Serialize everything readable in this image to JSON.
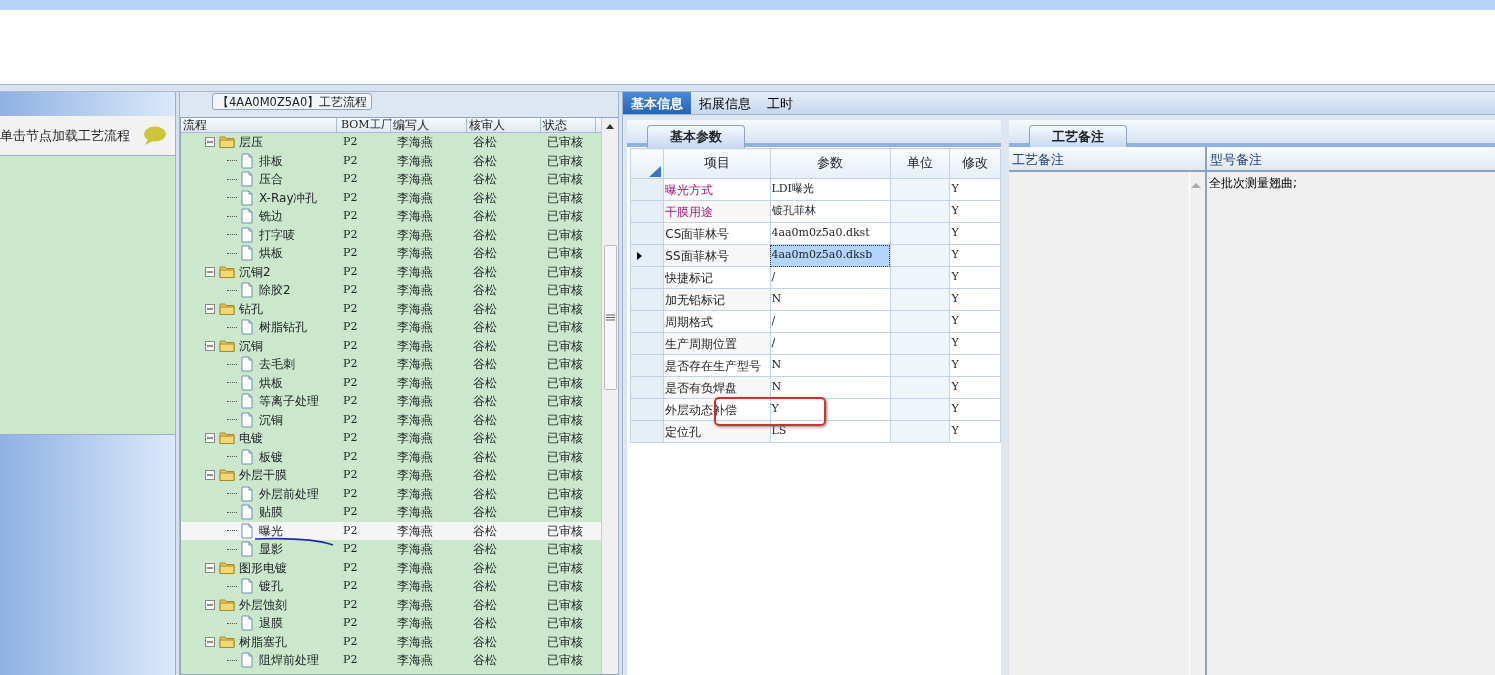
{
  "top_grid": {
    "rows": [
      {
        "selected": true
      }
    ]
  },
  "left_panel": {
    "hint": "单击节点加载工艺流程"
  },
  "process_panel": {
    "title": "【4AA0M0Z5A0】工艺流程",
    "columns": [
      "流程",
      "BOM工厂",
      "编写人",
      "核审人",
      "状态"
    ],
    "rows": [
      {
        "kind": "folder",
        "name": "层压",
        "bom": "P2",
        "writer": "李海燕",
        "reviewer": "谷松",
        "status": "已审核",
        "selected": false,
        "expanded": true,
        "children": [
          {
            "kind": "file",
            "name": "排板",
            "bom": "P2",
            "writer": "李海燕",
            "reviewer": "谷松",
            "status": "已审核",
            "selected": false
          },
          {
            "kind": "file",
            "name": "压合",
            "bom": "P2",
            "writer": "李海燕",
            "reviewer": "谷松",
            "status": "已审核",
            "selected": false
          },
          {
            "kind": "file",
            "name": "X-Ray冲孔",
            "bom": "P2",
            "writer": "李海燕",
            "reviewer": "谷松",
            "status": "已审核",
            "selected": false
          },
          {
            "kind": "file",
            "name": "铣边",
            "bom": "P2",
            "writer": "李海燕",
            "reviewer": "谷松",
            "status": "已审核",
            "selected": false
          },
          {
            "kind": "file",
            "name": "打字唛",
            "bom": "P2",
            "writer": "李海燕",
            "reviewer": "谷松",
            "status": "已审核",
            "selected": false
          },
          {
            "kind": "file",
            "name": "烘板",
            "bom": "P2",
            "writer": "李海燕",
            "reviewer": "谷松",
            "status": "已审核",
            "selected": false
          }
        ]
      },
      {
        "kind": "folder",
        "name": "沉铜2",
        "bom": "P2",
        "writer": "李海燕",
        "reviewer": "谷松",
        "status": "已审核",
        "selected": false,
        "expanded": true,
        "children": [
          {
            "kind": "file",
            "name": "除胶2",
            "bom": "P2",
            "writer": "李海燕",
            "reviewer": "谷松",
            "status": "已审核",
            "selected": false
          }
        ]
      },
      {
        "kind": "folder",
        "name": "钻孔",
        "bom": "P2",
        "writer": "李海燕",
        "reviewer": "谷松",
        "status": "已审核",
        "selected": false,
        "expanded": true,
        "children": [
          {
            "kind": "file",
            "name": "树脂钻孔",
            "bom": "P2",
            "writer": "李海燕",
            "reviewer": "谷松",
            "status": "已审核",
            "selected": false
          }
        ]
      },
      {
        "kind": "folder",
        "name": "沉铜",
        "bom": "P2",
        "writer": "李海燕",
        "reviewer": "谷松",
        "status": "已审核",
        "selected": false,
        "expanded": true,
        "children": [
          {
            "kind": "file",
            "name": "去毛刺",
            "bom": "P2",
            "writer": "李海燕",
            "reviewer": "谷松",
            "status": "已审核",
            "selected": false
          },
          {
            "kind": "file",
            "name": "烘板",
            "bom": "P2",
            "writer": "李海燕",
            "reviewer": "谷松",
            "status": "已审核",
            "selected": false
          },
          {
            "kind": "file",
            "name": "等离子处理",
            "bom": "P2",
            "writer": "李海燕",
            "reviewer": "谷松",
            "status": "已审核",
            "selected": false
          },
          {
            "kind": "file",
            "name": "沉铜",
            "bom": "P2",
            "writer": "李海燕",
            "reviewer": "谷松",
            "status": "已审核",
            "selected": false
          }
        ]
      },
      {
        "kind": "folder",
        "name": "电镀",
        "bom": "P2",
        "writer": "李海燕",
        "reviewer": "谷松",
        "status": "已审核",
        "selected": false,
        "expanded": true,
        "children": [
          {
            "kind": "file",
            "name": "板镀",
            "bom": "P2",
            "writer": "李海燕",
            "reviewer": "谷松",
            "status": "已审核",
            "selected": false
          }
        ]
      },
      {
        "kind": "folder",
        "name": "外层干膜",
        "bom": "P2",
        "writer": "李海燕",
        "reviewer": "谷松",
        "status": "已审核",
        "selected": false,
        "expanded": true,
        "children": [
          {
            "kind": "file",
            "name": "外层前处理",
            "bom": "P2",
            "writer": "李海燕",
            "reviewer": "谷松",
            "status": "已审核",
            "selected": false
          },
          {
            "kind": "file",
            "name": "贴膜",
            "bom": "P2",
            "writer": "李海燕",
            "reviewer": "谷松",
            "status": "已审核",
            "selected": false
          },
          {
            "kind": "file",
            "name": "曝光",
            "bom": "P2",
            "writer": "李海燕",
            "reviewer": "谷松",
            "status": "已审核",
            "selected": true
          },
          {
            "kind": "file",
            "name": "显影",
            "bom": "P2",
            "writer": "李海燕",
            "reviewer": "谷松",
            "status": "已审核",
            "selected": false
          }
        ]
      },
      {
        "kind": "folder",
        "name": "图形电镀",
        "bom": "P2",
        "writer": "李海燕",
        "reviewer": "谷松",
        "status": "已审核",
        "selected": false,
        "expanded": true,
        "children": [
          {
            "kind": "file",
            "name": "镀孔",
            "bom": "P2",
            "writer": "李海燕",
            "reviewer": "谷松",
            "status": "已审核",
            "selected": false
          }
        ]
      },
      {
        "kind": "folder",
        "name": "外层蚀刻",
        "bom": "P2",
        "writer": "李海燕",
        "reviewer": "谷松",
        "status": "已审核",
        "selected": false,
        "expanded": true,
        "children": [
          {
            "kind": "file",
            "name": "退膜",
            "bom": "P2",
            "writer": "李海燕",
            "reviewer": "谷松",
            "status": "已审核",
            "selected": false
          }
        ]
      },
      {
        "kind": "folder",
        "name": "树脂塞孔",
        "bom": "P2",
        "writer": "李海燕",
        "reviewer": "谷松",
        "status": "已审核",
        "selected": false,
        "expanded": true,
        "children": [
          {
            "kind": "file",
            "name": "阻焊前处理",
            "bom": "P2",
            "writer": "李海燕",
            "reviewer": "谷松",
            "status": "已审核",
            "selected": false
          }
        ]
      }
    ]
  },
  "detail_tabs": [
    {
      "label": "基本信息",
      "selected": true
    },
    {
      "label": "拓展信息",
      "selected": false
    },
    {
      "label": "工时",
      "selected": false
    }
  ],
  "params": {
    "tab": "基本参数",
    "columns": [
      "项目",
      "参数",
      "单位",
      "修改"
    ],
    "rows": [
      {
        "item": "曝光方式",
        "emphasized": true,
        "value": "LDI曝光",
        "modify": "Y",
        "current": false
      },
      {
        "item": "干膜用途",
        "emphasized": true,
        "value": "镀孔菲林",
        "modify": "Y",
        "current": false
      },
      {
        "item": "CS面菲林号",
        "emphasized": false,
        "value": "4aa0m0z5a0.dkst",
        "modify": "Y",
        "current": false
      },
      {
        "item": "SS面菲林号",
        "emphasized": false,
        "value": "4aa0m0z5a0.dksb",
        "modify": "Y",
        "current": true
      },
      {
        "item": "快捷标记",
        "emphasized": false,
        "value": "/",
        "modify": "Y",
        "current": false
      },
      {
        "item": "加无铅标记",
        "emphasized": false,
        "value": "N",
        "modify": "Y",
        "current": false
      },
      {
        "item": "周期格式",
        "emphasized": false,
        "value": "/",
        "modify": "Y",
        "current": false
      },
      {
        "item": "生产周期位置",
        "emphasized": false,
        "value": "/",
        "modify": "Y",
        "current": false
      },
      {
        "item": "是否存在生产型号",
        "emphasized": false,
        "value": "N",
        "modify": "Y",
        "current": false
      },
      {
        "item": "是否有负焊盘",
        "emphasized": false,
        "value": "N",
        "modify": "Y",
        "current": false
      },
      {
        "item": "外层动态补偿",
        "emphasized": false,
        "value": "Y",
        "modify": "Y",
        "current": false
      },
      {
        "item": "定位孔",
        "emphasized": false,
        "value": "LS",
        "modify": "Y",
        "current": false
      }
    ]
  },
  "notes": {
    "tab": "工艺备注",
    "columns": [
      "工艺备注",
      "型号备注"
    ],
    "model_note": "全批次测量翘曲;"
  }
}
